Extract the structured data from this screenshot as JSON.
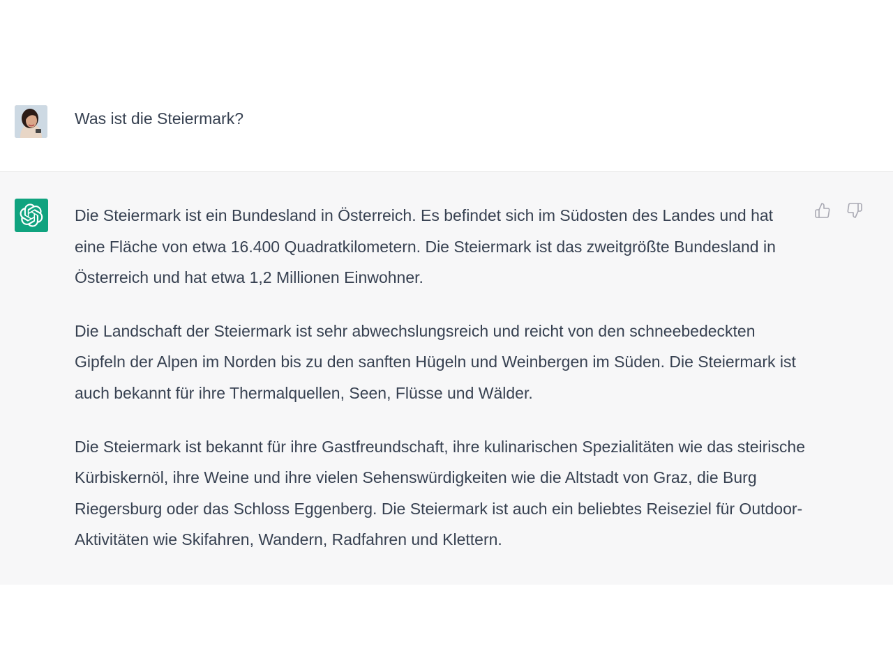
{
  "conversation": {
    "user_message": {
      "text": "Was ist die Steiermark?",
      "avatar_icon": "user-avatar-photo"
    },
    "assistant_message": {
      "avatar_icon": "openai-logo-icon",
      "paragraphs": [
        "Die Steiermark ist ein Bundesland in Österreich. Es befindet sich im Südosten des Landes und hat eine Fläche von etwa 16.400 Quadratkilometern. Die Steiermark ist das zweitgrößte Bundesland in Österreich und hat etwa 1,2 Millionen Einwohner.",
        "Die Landschaft der Steiermark ist sehr abwechslungsreich und reicht von den schneebedeckten Gipfeln der Alpen im Norden bis zu den sanften Hügeln und Weinbergen im Süden. Die Steiermark ist auch bekannt für ihre Thermalquellen, Seen, Flüsse und Wälder.",
        "Die Steiermark ist bekannt für ihre Gastfreundschaft, ihre kulinarischen Spezialitäten wie das steirische Kürbiskernöl, ihre Weine und ihre vielen Sehenswürdigkeiten wie die Altstadt von Graz, die Burg Riegersburg oder das Schloss Eggenberg. Die Steiermark ist auch ein beliebtes Reiseziel für Outdoor-Aktivitäten wie Skifahren, Wandern, Radfahren und Klettern."
      ],
      "feedback": {
        "like_icon": "thumbs-up-icon",
        "dislike_icon": "thumbs-down-icon"
      }
    }
  },
  "colors": {
    "assistant_bg": "#f7f7f8",
    "text": "#374151",
    "brand_green": "#10a37f",
    "icon_gray": "#a9a9b3"
  }
}
